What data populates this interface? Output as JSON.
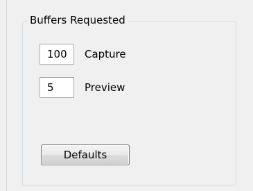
{
  "buffers_group": {
    "title": "Buffers Requested",
    "capture": {
      "value": "100",
      "label": "Capture"
    },
    "preview": {
      "value": "5",
      "label": "Preview"
    },
    "defaults_button_label": "Defaults"
  }
}
